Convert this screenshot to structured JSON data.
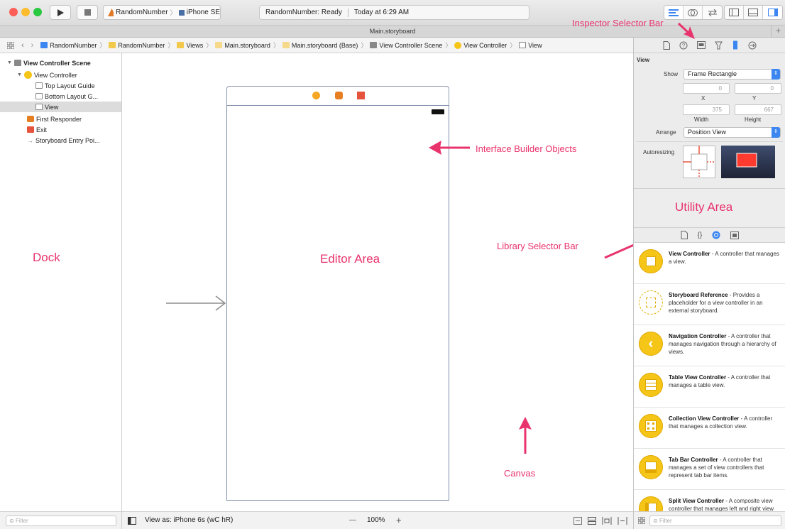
{
  "toolbar": {
    "scheme_project": "RandomNumber",
    "scheme_device": "iPhone SE",
    "status_title": "RandomNumber: Ready",
    "status_time": "Today at 6:29 AM"
  },
  "tab": {
    "title": "Main.storyboard",
    "plus": "+"
  },
  "jumpbar": {
    "crumbs": [
      "RandomNumber",
      "RandomNumber",
      "Views",
      "Main.storyboard",
      "Main.storyboard (Base)",
      "View Controller Scene",
      "View Controller",
      "View"
    ]
  },
  "dock": {
    "tree": [
      "View Controller Scene",
      "View Controller",
      "Top Layout Guide",
      "Bottom Layout G...",
      "View",
      "First Responder",
      "Exit",
      "Storyboard Entry Poi..."
    ]
  },
  "annotations": {
    "inspector_selector_bar": "Inspector Selector Bar",
    "interface_builder_objects": "Interface Builder Objects",
    "utility_area": "Utility Area",
    "library_selector_bar": "Library Selector Bar",
    "dock": "Dock",
    "editor_area": "Editor Area",
    "canvas": "Canvas"
  },
  "inspector": {
    "section": "View",
    "show_label": "Show",
    "show_value": "Frame Rectangle",
    "x_value": "0",
    "y_value": "0",
    "x_label": "X",
    "y_label": "Y",
    "width_value": "375",
    "height_value": "667",
    "width_label": "Width",
    "height_label": "Height",
    "arrange_label": "Arrange",
    "arrange_value": "Position View",
    "autoresizing_label": "Autoresizing"
  },
  "library": [
    {
      "title": "View Controller",
      "desc": " - A controller that manages a view."
    },
    {
      "title": "Storyboard Reference",
      "desc": " - Provides a placeholder for a view controller in an external storyboard."
    },
    {
      "title": "Navigation Controller",
      "desc": " - A controller that manages navigation through a hierarchy of views."
    },
    {
      "title": "Table View Controller",
      "desc": " - A controller that manages a table view."
    },
    {
      "title": "Collection View Controller",
      "desc": " - A controller that manages a collection view."
    },
    {
      "title": "Tab Bar Controller",
      "desc": " - A controller that manages a set of view controllers that represent tab bar items."
    },
    {
      "title": "Split View Controller",
      "desc": " - A composite view controller that manages left and right view controlle..."
    }
  ],
  "bottom": {
    "filter_placeholder": "Filter",
    "view_as": "View as: iPhone 6s (wC hR)",
    "zoom_minus": "—",
    "zoom": "100%",
    "zoom_plus": "+",
    "library_filter_placeholder": "Filter"
  },
  "colors": {
    "annotation": "#e8336d",
    "accent": "#3b86f0",
    "library_icon": "#f5c518"
  }
}
